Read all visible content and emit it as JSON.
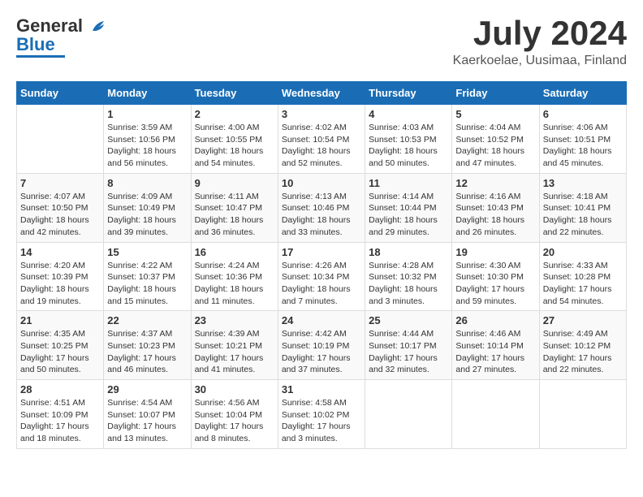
{
  "header": {
    "logo_line1": "General",
    "logo_line2": "Blue",
    "month": "July 2024",
    "location": "Kaerkoelae, Uusimaa, Finland"
  },
  "days_of_week": [
    "Sunday",
    "Monday",
    "Tuesday",
    "Wednesday",
    "Thursday",
    "Friday",
    "Saturday"
  ],
  "weeks": [
    [
      {
        "day": "",
        "sunrise": "",
        "sunset": "",
        "daylight": ""
      },
      {
        "day": "1",
        "sunrise": "Sunrise: 3:59 AM",
        "sunset": "Sunset: 10:56 PM",
        "daylight": "Daylight: 18 hours and 56 minutes."
      },
      {
        "day": "2",
        "sunrise": "Sunrise: 4:00 AM",
        "sunset": "Sunset: 10:55 PM",
        "daylight": "Daylight: 18 hours and 54 minutes."
      },
      {
        "day": "3",
        "sunrise": "Sunrise: 4:02 AM",
        "sunset": "Sunset: 10:54 PM",
        "daylight": "Daylight: 18 hours and 52 minutes."
      },
      {
        "day": "4",
        "sunrise": "Sunrise: 4:03 AM",
        "sunset": "Sunset: 10:53 PM",
        "daylight": "Daylight: 18 hours and 50 minutes."
      },
      {
        "day": "5",
        "sunrise": "Sunrise: 4:04 AM",
        "sunset": "Sunset: 10:52 PM",
        "daylight": "Daylight: 18 hours and 47 minutes."
      },
      {
        "day": "6",
        "sunrise": "Sunrise: 4:06 AM",
        "sunset": "Sunset: 10:51 PM",
        "daylight": "Daylight: 18 hours and 45 minutes."
      }
    ],
    [
      {
        "day": "7",
        "sunrise": "Sunrise: 4:07 AM",
        "sunset": "Sunset: 10:50 PM",
        "daylight": "Daylight: 18 hours and 42 minutes."
      },
      {
        "day": "8",
        "sunrise": "Sunrise: 4:09 AM",
        "sunset": "Sunset: 10:49 PM",
        "daylight": "Daylight: 18 hours and 39 minutes."
      },
      {
        "day": "9",
        "sunrise": "Sunrise: 4:11 AM",
        "sunset": "Sunset: 10:47 PM",
        "daylight": "Daylight: 18 hours and 36 minutes."
      },
      {
        "day": "10",
        "sunrise": "Sunrise: 4:13 AM",
        "sunset": "Sunset: 10:46 PM",
        "daylight": "Daylight: 18 hours and 33 minutes."
      },
      {
        "day": "11",
        "sunrise": "Sunrise: 4:14 AM",
        "sunset": "Sunset: 10:44 PM",
        "daylight": "Daylight: 18 hours and 29 minutes."
      },
      {
        "day": "12",
        "sunrise": "Sunrise: 4:16 AM",
        "sunset": "Sunset: 10:43 PM",
        "daylight": "Daylight: 18 hours and 26 minutes."
      },
      {
        "day": "13",
        "sunrise": "Sunrise: 4:18 AM",
        "sunset": "Sunset: 10:41 PM",
        "daylight": "Daylight: 18 hours and 22 minutes."
      }
    ],
    [
      {
        "day": "14",
        "sunrise": "Sunrise: 4:20 AM",
        "sunset": "Sunset: 10:39 PM",
        "daylight": "Daylight: 18 hours and 19 minutes."
      },
      {
        "day": "15",
        "sunrise": "Sunrise: 4:22 AM",
        "sunset": "Sunset: 10:37 PM",
        "daylight": "Daylight: 18 hours and 15 minutes."
      },
      {
        "day": "16",
        "sunrise": "Sunrise: 4:24 AM",
        "sunset": "Sunset: 10:36 PM",
        "daylight": "Daylight: 18 hours and 11 minutes."
      },
      {
        "day": "17",
        "sunrise": "Sunrise: 4:26 AM",
        "sunset": "Sunset: 10:34 PM",
        "daylight": "Daylight: 18 hours and 7 minutes."
      },
      {
        "day": "18",
        "sunrise": "Sunrise: 4:28 AM",
        "sunset": "Sunset: 10:32 PM",
        "daylight": "Daylight: 18 hours and 3 minutes."
      },
      {
        "day": "19",
        "sunrise": "Sunrise: 4:30 AM",
        "sunset": "Sunset: 10:30 PM",
        "daylight": "Daylight: 17 hours and 59 minutes."
      },
      {
        "day": "20",
        "sunrise": "Sunrise: 4:33 AM",
        "sunset": "Sunset: 10:28 PM",
        "daylight": "Daylight: 17 hours and 54 minutes."
      }
    ],
    [
      {
        "day": "21",
        "sunrise": "Sunrise: 4:35 AM",
        "sunset": "Sunset: 10:25 PM",
        "daylight": "Daylight: 17 hours and 50 minutes."
      },
      {
        "day": "22",
        "sunrise": "Sunrise: 4:37 AM",
        "sunset": "Sunset: 10:23 PM",
        "daylight": "Daylight: 17 hours and 46 minutes."
      },
      {
        "day": "23",
        "sunrise": "Sunrise: 4:39 AM",
        "sunset": "Sunset: 10:21 PM",
        "daylight": "Daylight: 17 hours and 41 minutes."
      },
      {
        "day": "24",
        "sunrise": "Sunrise: 4:42 AM",
        "sunset": "Sunset: 10:19 PM",
        "daylight": "Daylight: 17 hours and 37 minutes."
      },
      {
        "day": "25",
        "sunrise": "Sunrise: 4:44 AM",
        "sunset": "Sunset: 10:17 PM",
        "daylight": "Daylight: 17 hours and 32 minutes."
      },
      {
        "day": "26",
        "sunrise": "Sunrise: 4:46 AM",
        "sunset": "Sunset: 10:14 PM",
        "daylight": "Daylight: 17 hours and 27 minutes."
      },
      {
        "day": "27",
        "sunrise": "Sunrise: 4:49 AM",
        "sunset": "Sunset: 10:12 PM",
        "daylight": "Daylight: 17 hours and 22 minutes."
      }
    ],
    [
      {
        "day": "28",
        "sunrise": "Sunrise: 4:51 AM",
        "sunset": "Sunset: 10:09 PM",
        "daylight": "Daylight: 17 hours and 18 minutes."
      },
      {
        "day": "29",
        "sunrise": "Sunrise: 4:54 AM",
        "sunset": "Sunset: 10:07 PM",
        "daylight": "Daylight: 17 hours and 13 minutes."
      },
      {
        "day": "30",
        "sunrise": "Sunrise: 4:56 AM",
        "sunset": "Sunset: 10:04 PM",
        "daylight": "Daylight: 17 hours and 8 minutes."
      },
      {
        "day": "31",
        "sunrise": "Sunrise: 4:58 AM",
        "sunset": "Sunset: 10:02 PM",
        "daylight": "Daylight: 17 hours and 3 minutes."
      },
      {
        "day": "",
        "sunrise": "",
        "sunset": "",
        "daylight": ""
      },
      {
        "day": "",
        "sunrise": "",
        "sunset": "",
        "daylight": ""
      },
      {
        "day": "",
        "sunrise": "",
        "sunset": "",
        "daylight": ""
      }
    ]
  ]
}
